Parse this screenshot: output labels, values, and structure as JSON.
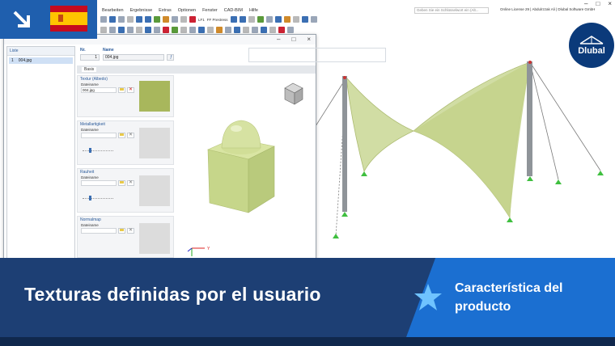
{
  "app": {
    "menu": [
      "Bearbeiten",
      "Ergebnisse",
      "Extras",
      "Optionen",
      "Fenster",
      "CAD-BIM",
      "Hilfe"
    ],
    "search_placeholder": "Geben Sie ein Schlüsselwort ein (Alt...",
    "license_text": "Online License 29 | Abdulrzzak Ali | Dlubal Software GmbH",
    "toolbar_lf_label": "LF1",
    "toolbar_load_label": "FF Prestress"
  },
  "logo": {
    "text": "Dlubal"
  },
  "dialog": {
    "list_header": "Liste",
    "list_items": [
      {
        "no": "1",
        "name": "004.jpg"
      }
    ],
    "no_label": "Nr.",
    "no_value": "1",
    "name_label": "Name",
    "name_value": "004.jpg",
    "tab_base": "Basis",
    "sections": [
      {
        "title": "Textur (Albedo)",
        "file_label": "Dateiname",
        "file_value": "004.jpg"
      },
      {
        "title": "Metallartigkeit",
        "file_label": "Dateiname",
        "file_value": ""
      },
      {
        "title": "Rauheit",
        "file_label": "Dateiname",
        "file_value": ""
      },
      {
        "title": "Normalmap",
        "file_label": "Dateiname",
        "file_value": ""
      }
    ],
    "axis_y": "Y"
  },
  "banner": {
    "title": "Texturas definidas por el usuario",
    "feature": "Característica del producto"
  },
  "colors": {
    "banner_dark": "#1d3f74",
    "feature_blue": "#1b6fd1",
    "texture_green": "#bfd17e",
    "support_green": "#3fbf3f"
  }
}
